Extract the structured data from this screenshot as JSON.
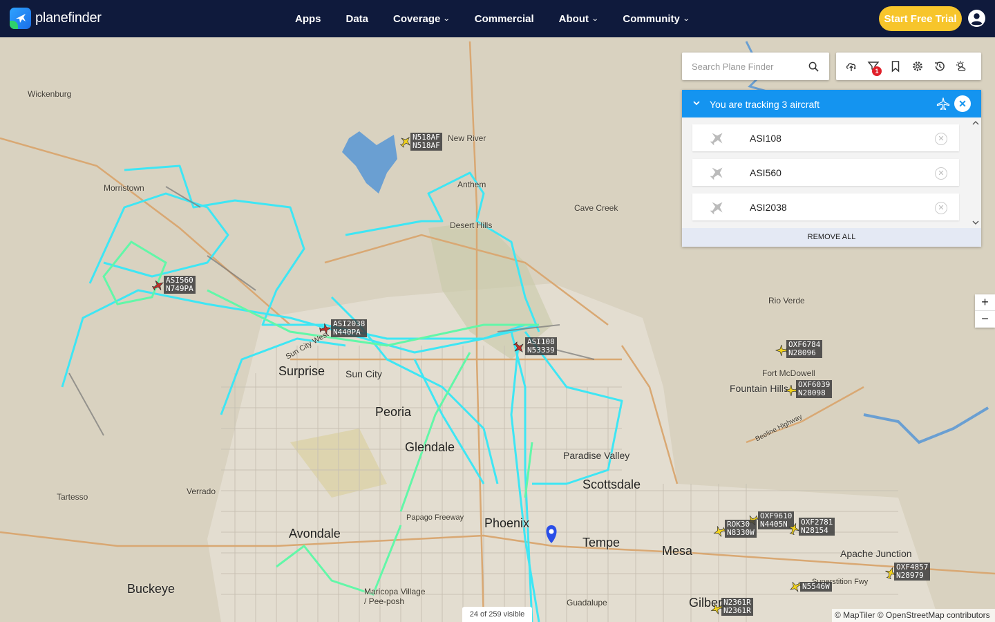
{
  "brand": {
    "name": "planefinder"
  },
  "nav": {
    "items": [
      {
        "label": "Apps",
        "dropdown": false
      },
      {
        "label": "Data",
        "dropdown": false
      },
      {
        "label": "Coverage",
        "dropdown": true
      },
      {
        "label": "Commercial",
        "dropdown": false
      },
      {
        "label": "About",
        "dropdown": true
      },
      {
        "label": "Community",
        "dropdown": true
      }
    ],
    "trial_button": "Start Free Trial"
  },
  "search": {
    "placeholder": "Search Plane Finder"
  },
  "toolbar": {
    "filter_badge": "1",
    "icons": [
      "upload-cloud-icon",
      "filter-icon",
      "bookmark-icon",
      "settings-icon",
      "history-icon",
      "weather-icon"
    ]
  },
  "tracking": {
    "title": "You are tracking 3 aircraft",
    "items": [
      {
        "label": "ASI108"
      },
      {
        "label": "ASI560"
      },
      {
        "label": "ASI2038"
      }
    ],
    "remove_all": "REMOVE ALL"
  },
  "map": {
    "places": [
      {
        "name": "Wickenburg"
      },
      {
        "name": "Morristown"
      },
      {
        "name": "New River"
      },
      {
        "name": "Anthem"
      },
      {
        "name": "Cave Creek"
      },
      {
        "name": "Desert Hills"
      },
      {
        "name": "Rio Verde"
      },
      {
        "name": "Fort McDowell"
      },
      {
        "name": "Fountain Hills"
      },
      {
        "name": "Surprise"
      },
      {
        "name": "Sun City"
      },
      {
        "name": "Peoria"
      },
      {
        "name": "Glendale"
      },
      {
        "name": "Paradise Valley"
      },
      {
        "name": "Scottsdale"
      },
      {
        "name": "Phoenix"
      },
      {
        "name": "Tempe"
      },
      {
        "name": "Mesa"
      },
      {
        "name": "Apache Junction"
      },
      {
        "name": "Avondale"
      },
      {
        "name": "Buckeye"
      },
      {
        "name": "Tartesso"
      },
      {
        "name": "Verrado"
      },
      {
        "name": "Gilbert"
      },
      {
        "name": "Guadalupe"
      },
      {
        "name": "Maricopa Village / Pee-posh"
      },
      {
        "name": "Papago Freeway"
      },
      {
        "name": "Beeline Highway"
      },
      {
        "name": "Superstition Fwy"
      },
      {
        "name": "Sun City West"
      }
    ],
    "aircraft": [
      {
        "callsign": "N518AF",
        "reg": "N518AF",
        "tracked": false
      },
      {
        "callsign": "ASI560",
        "reg": "N749PA",
        "tracked": true
      },
      {
        "callsign": "ASI2038",
        "reg": "N440PA",
        "tracked": true
      },
      {
        "callsign": "ASI108",
        "reg": "N53339",
        "tracked": true
      },
      {
        "callsign": "OXF6784",
        "reg": "N28096",
        "tracked": false
      },
      {
        "callsign": "OXF6039",
        "reg": "N28098",
        "tracked": false
      },
      {
        "callsign": "OXF9610",
        "reg": "N4405N",
        "tracked": false
      },
      {
        "callsign": "ROK30",
        "reg": "N8330W",
        "tracked": false
      },
      {
        "callsign": "OXF2781",
        "reg": "N28154",
        "tracked": false
      },
      {
        "callsign": "OXF4857",
        "reg": "N28979",
        "tracked": false
      },
      {
        "callsign": "N5546W",
        "reg": "",
        "tracked": false
      },
      {
        "callsign": "N2361R",
        "reg": "N2361R",
        "tracked": false
      }
    ],
    "visible_count": "24 of 259 visible",
    "attribution": "© MapTiler © OpenStreetMap contributors"
  },
  "colors": {
    "nav_bg": "#0f1a3c",
    "accent": "#1494f0",
    "trial": "#f7c52b",
    "track_cyan": "#3ee6f4",
    "track_green": "#62f7a8"
  }
}
